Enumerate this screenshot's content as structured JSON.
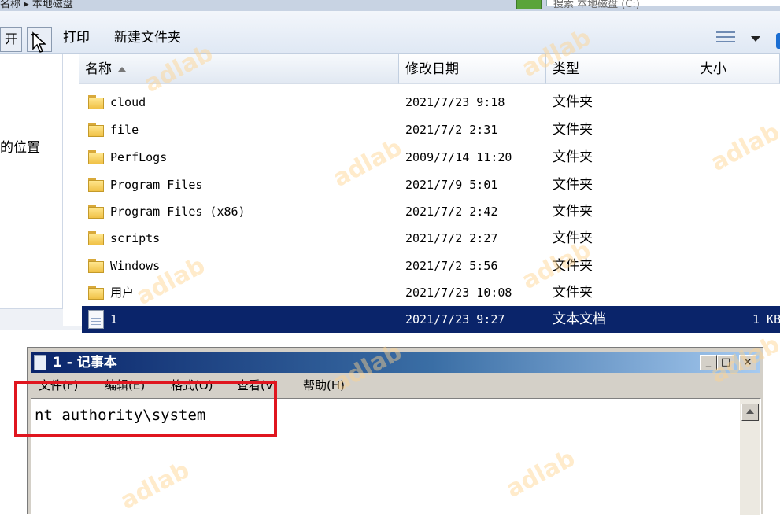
{
  "top": {
    "path_text": "名称 ▸ 本地磁盘",
    "search_placeholder": "搜索 本地磁盘 (C:)"
  },
  "toolbar": {
    "open_label": "开",
    "print_label": "打印",
    "new_folder_label": "新建文件夹"
  },
  "navpane": {
    "location_label": "的位置"
  },
  "columns": {
    "name": "名称",
    "date": "修改日期",
    "type": "类型",
    "size": "大小"
  },
  "files": [
    {
      "name": "cloud",
      "date": "2021/7/23 9:18",
      "type": "文件夹",
      "size": "",
      "kind": "folder"
    },
    {
      "name": "file",
      "date": "2021/7/2 2:31",
      "type": "文件夹",
      "size": "",
      "kind": "folder"
    },
    {
      "name": "PerfLogs",
      "date": "2009/7/14 11:20",
      "type": "文件夹",
      "size": "",
      "kind": "folder"
    },
    {
      "name": "Program Files",
      "date": "2021/7/9 5:01",
      "type": "文件夹",
      "size": "",
      "kind": "folder"
    },
    {
      "name": "Program Files (x86)",
      "date": "2021/7/2 2:42",
      "type": "文件夹",
      "size": "",
      "kind": "folder"
    },
    {
      "name": "scripts",
      "date": "2021/7/2 2:27",
      "type": "文件夹",
      "size": "",
      "kind": "folder"
    },
    {
      "name": "Windows",
      "date": "2021/7/2 5:56",
      "type": "文件夹",
      "size": "",
      "kind": "folder"
    },
    {
      "name": "用户",
      "date": "2021/7/23 10:08",
      "type": "文件夹",
      "size": "",
      "kind": "folder"
    },
    {
      "name": "1",
      "date": "2021/7/23 9:27",
      "type": "文本文档",
      "size": "1 KB",
      "kind": "text",
      "selected": true
    }
  ],
  "notepad": {
    "title": "1 - 记事本",
    "minimize_label": "_",
    "maximize_label": "□",
    "close_label": "×",
    "menu": [
      "文件(F)",
      "编辑(E)",
      "格式(O)",
      "查看(V)",
      "帮助(H)"
    ],
    "content": "nt authority\\system"
  },
  "watermark": "adlab",
  "colors": {
    "selection": "#0a246a",
    "highlight_box": "#e0161f",
    "title_bar": "#0a246a"
  }
}
